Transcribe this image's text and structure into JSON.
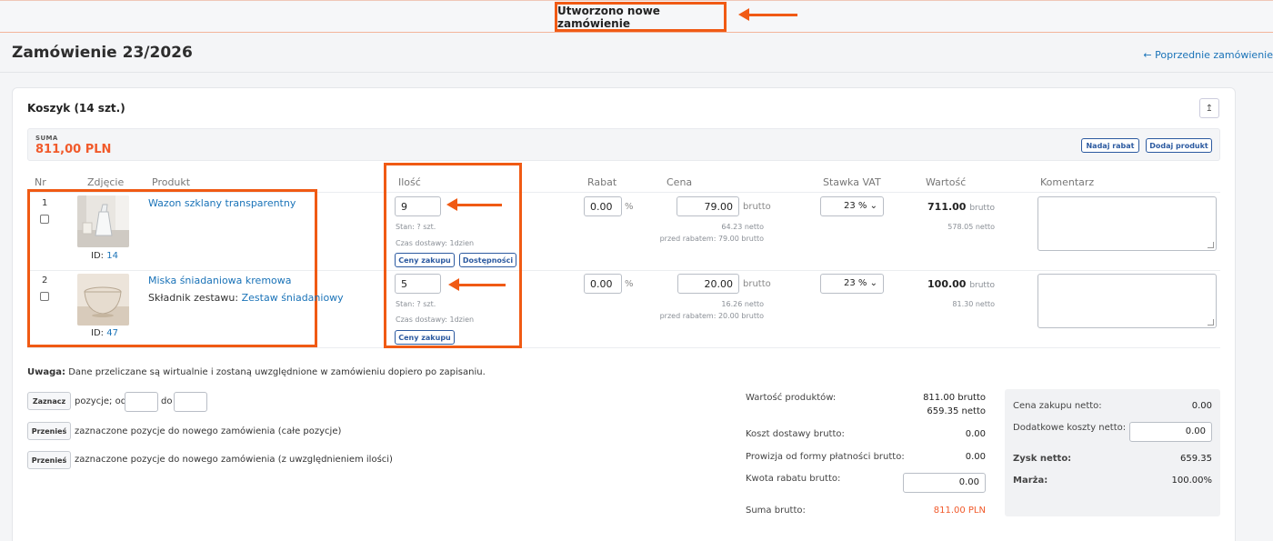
{
  "notification": {
    "text": "Utworzono nowe zamówienie"
  },
  "header": {
    "title": "Zamówienie 23/2026",
    "prev_link": "← Poprzednie zamówienie"
  },
  "cart": {
    "title": "Koszyk (14 szt.)",
    "collapse_icon": "↥",
    "sum_label": "SUMA",
    "sum_value": "811,00 PLN",
    "discount_button": "Nadaj rabat",
    "add_product_button": "Dodaj produkt"
  },
  "table": {
    "headers": {
      "nr": "Nr",
      "photo": "Zdjęcie",
      "product": "Produkt",
      "qty": "Ilość",
      "discount": "Rabat",
      "price": "Cena",
      "vat": "Stawka VAT",
      "value": "Wartość",
      "comment": "Komentarz"
    },
    "rows": [
      {
        "nr": "1",
        "id_label": "ID:",
        "id": "14",
        "name": "Wazon szklany transparentny",
        "qty": "9",
        "stock": "Stan: ? szt.",
        "delivery": "Czas dostawy: 1dzien",
        "btn_prices": "Ceny zakupu",
        "btn_avail": "Dostępności",
        "discount": "0.00",
        "discount_unit": "%",
        "price": "79.00",
        "price_unit": "brutto",
        "net": "64.23 netto",
        "before": "przed rabatem: 79.00 brutto",
        "vat": "23 %",
        "value": "711.00",
        "value_unit": "brutto",
        "value_net": "578.05 netto"
      },
      {
        "nr": "2",
        "id_label": "ID:",
        "id": "47",
        "name": "Miska śniadaniowa kremowa",
        "set_label": "Składnik zestawu:",
        "set_name": "Zestaw śniadaniowy",
        "qty": "5",
        "stock": "Stan: ? szt.",
        "delivery": "Czas dostawy: 1dzien",
        "btn_prices": "Ceny zakupu",
        "discount": "0.00",
        "discount_unit": "%",
        "price": "20.00",
        "price_unit": "brutto",
        "net": "16.26 netto",
        "before": "przed rabatem: 20.00 brutto",
        "vat": "23 %",
        "value": "100.00",
        "value_unit": "brutto",
        "value_net": "81.30 netto"
      }
    ]
  },
  "note": {
    "bold": "Uwaga:",
    "text": " Dane przeliczane są wirtualnie i zostaną uwzględnione w zamówieniu dopiero po zapisaniu."
  },
  "selection": {
    "btn_mark": "Zaznacz",
    "positions_from": "pozycje; od",
    "to": "do",
    "btn_move": "Przenieś",
    "move_whole": "zaznaczone pozycje do nowego zamówienia (całe pozycje)",
    "move_qty": "zaznaczone pozycje do nowego zamówienia (z uwzględnieniem ilości)"
  },
  "summary": {
    "products_label": "Wartość produktów:",
    "products_gross": "811.00 brutto",
    "products_net": "659.35 netto",
    "shipping_label": "Koszt dostawy brutto:",
    "shipping": "0.00",
    "commission_label": "Prowizja od formy płatności brutto:",
    "commission": "0.00",
    "discount_label": "Kwota rabatu brutto:",
    "discount": "0.00",
    "total_label": "Suma brutto:",
    "total": "811.00 PLN"
  },
  "profit": {
    "purchase_label": "Cena zakupu netto:",
    "purchase": "0.00",
    "extra_label": "Dodatkowe koszty netto:",
    "extra": "0.00",
    "profit_label": "Zysk netto:",
    "profit": "659.35",
    "margin_label": "Marża:",
    "margin": "100.00%"
  },
  "colors": {
    "accent": "#f05a14",
    "link": "#1a73b8",
    "sum": "#f15a2b",
    "button": "#2c5aa0"
  }
}
